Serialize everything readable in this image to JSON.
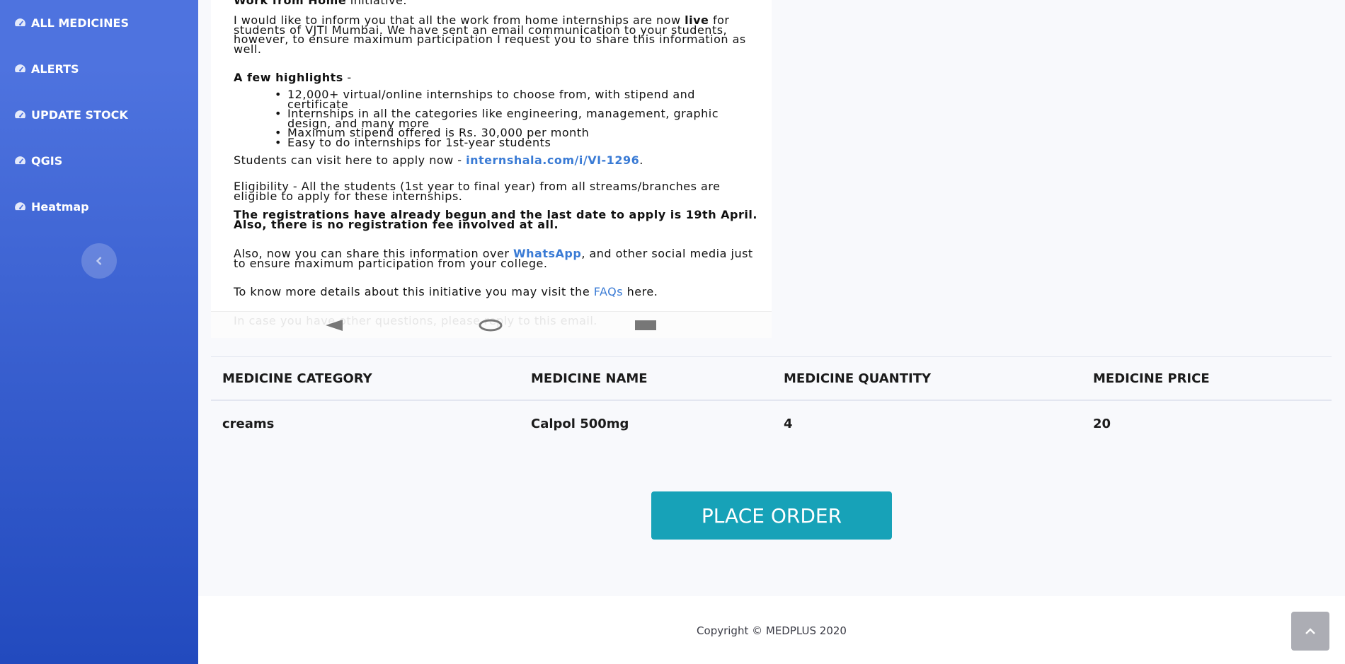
{
  "sidebar": {
    "items": [
      {
        "label": "ALL MEDICINES",
        "icon": "tachometer-icon"
      },
      {
        "label": "ALERTS",
        "icon": "tachometer-icon"
      },
      {
        "label": "UPDATE STOCK",
        "icon": "tachometer-icon"
      },
      {
        "label": "QGIS",
        "icon": "tachometer-icon"
      },
      {
        "label": "Heatmap",
        "icon": "tachometer-icon"
      }
    ],
    "toggle_icon": "chevron-left-icon",
    "colors": {
      "gradient_start": "#4e73df",
      "gradient_end": "#224abe"
    }
  },
  "email": {
    "top_cut": "Work from Home",
    "top_cut_after": " initiative.",
    "para1_a": "I would like to inform you that all the work from home internships are now ",
    "para1_live": "live",
    "para1_b": " for students of VJTI Mumbai. We have sent an email communication to your students, however, to ensure maximum participation I request you to share this information as well.",
    "highlights_title": "A few highlights",
    "highlights_dash": " -",
    "highlights": [
      "12,000+ virtual/online internships to choose from, with stipend and certificate",
      "Internships in all the categories like engineering, management, graphic design, and many more",
      "Maximum stipend offered is Rs. 30,000 per month",
      "Easy to do internships for 1st-year students"
    ],
    "apply_text": "Students can visit here to apply now - ",
    "apply_link": "internshala.com/i/VI-1296",
    "apply_end": ".",
    "eligibility": "Eligibility - All the students (1st year to final year) from all streams/branches are eligible to apply for these internships.",
    "registration": "The registrations have already begun and the last date to apply is 19th April. Also, there is no registration fee involved at all.",
    "share_a": "Also, now you can share this information over ",
    "share_link": "WhatsApp",
    "share_b": ", and other social media just to ensure maximum participation from your college.",
    "faq_a": "To know more details about this initiative you may visit the ",
    "faq_link": "FAQs",
    "faq_b": " here.",
    "fade_line": "In case you have other questions, please reply to this email."
  },
  "table": {
    "headers": [
      "MEDICINE CATEGORY",
      "MEDICINE NAME",
      "MEDICINE QUANTITY",
      "MEDICINE PRICE"
    ],
    "rows": [
      [
        "creams",
        "Calpol 500mg",
        "4",
        "20"
      ]
    ]
  },
  "order_button": {
    "label": "PLACE ORDER",
    "color": "#17a2b8"
  },
  "footer": {
    "copyright": "Copyright © MEDPLUS 2020"
  },
  "scroll_top_icon": "chevron-up-icon"
}
